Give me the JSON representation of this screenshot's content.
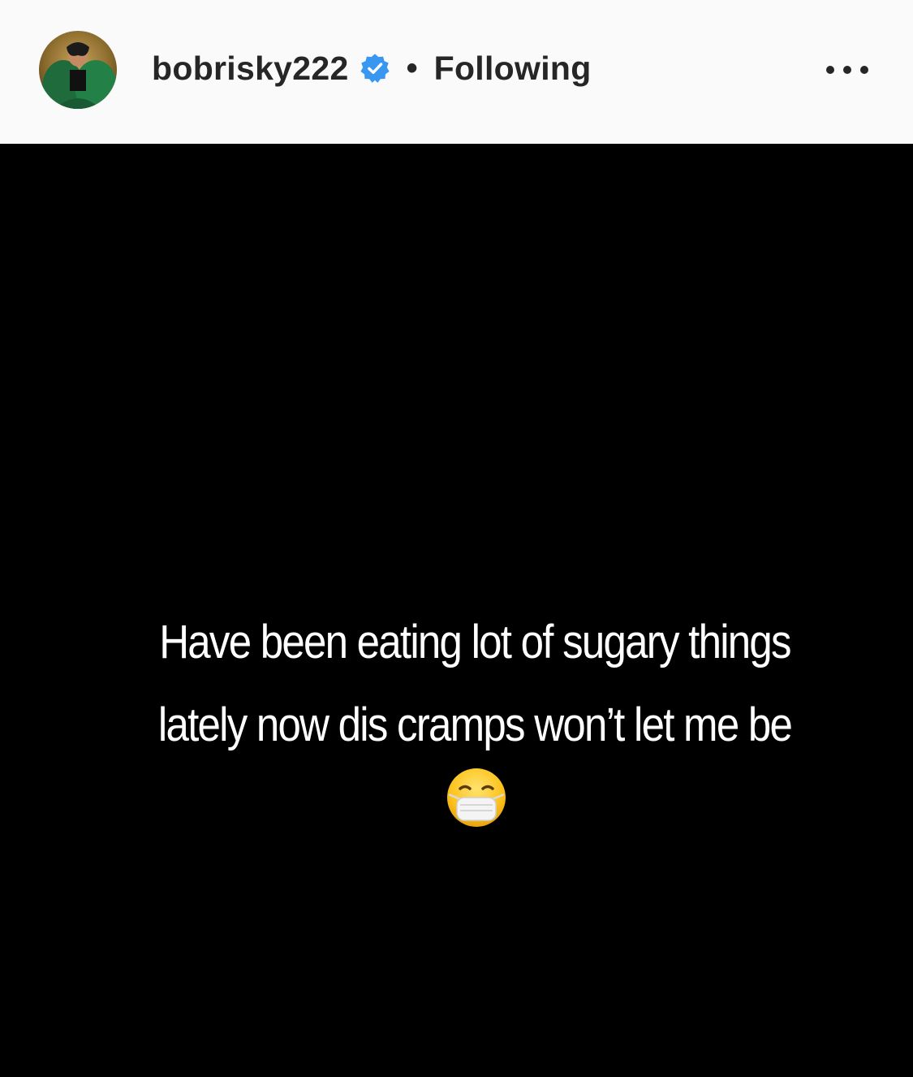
{
  "header": {
    "username": "bobrisky222",
    "verified": true,
    "separator": "•",
    "follow_status": "Following",
    "avatar_icon": "profile-avatar",
    "verified_icon": "verified-badge-icon",
    "more_icon": "more-options-icon"
  },
  "post": {
    "caption_lines": [
      "Have been eating lot of sugary things",
      "lately now dis cramps won’t let me be"
    ],
    "emoji": "face-with-medical-mask",
    "background_color": "#000000",
    "text_color": "#ffffff"
  },
  "colors": {
    "header_bg": "#fafafa",
    "text_primary": "#262626",
    "verified_blue": "#3897f0"
  }
}
